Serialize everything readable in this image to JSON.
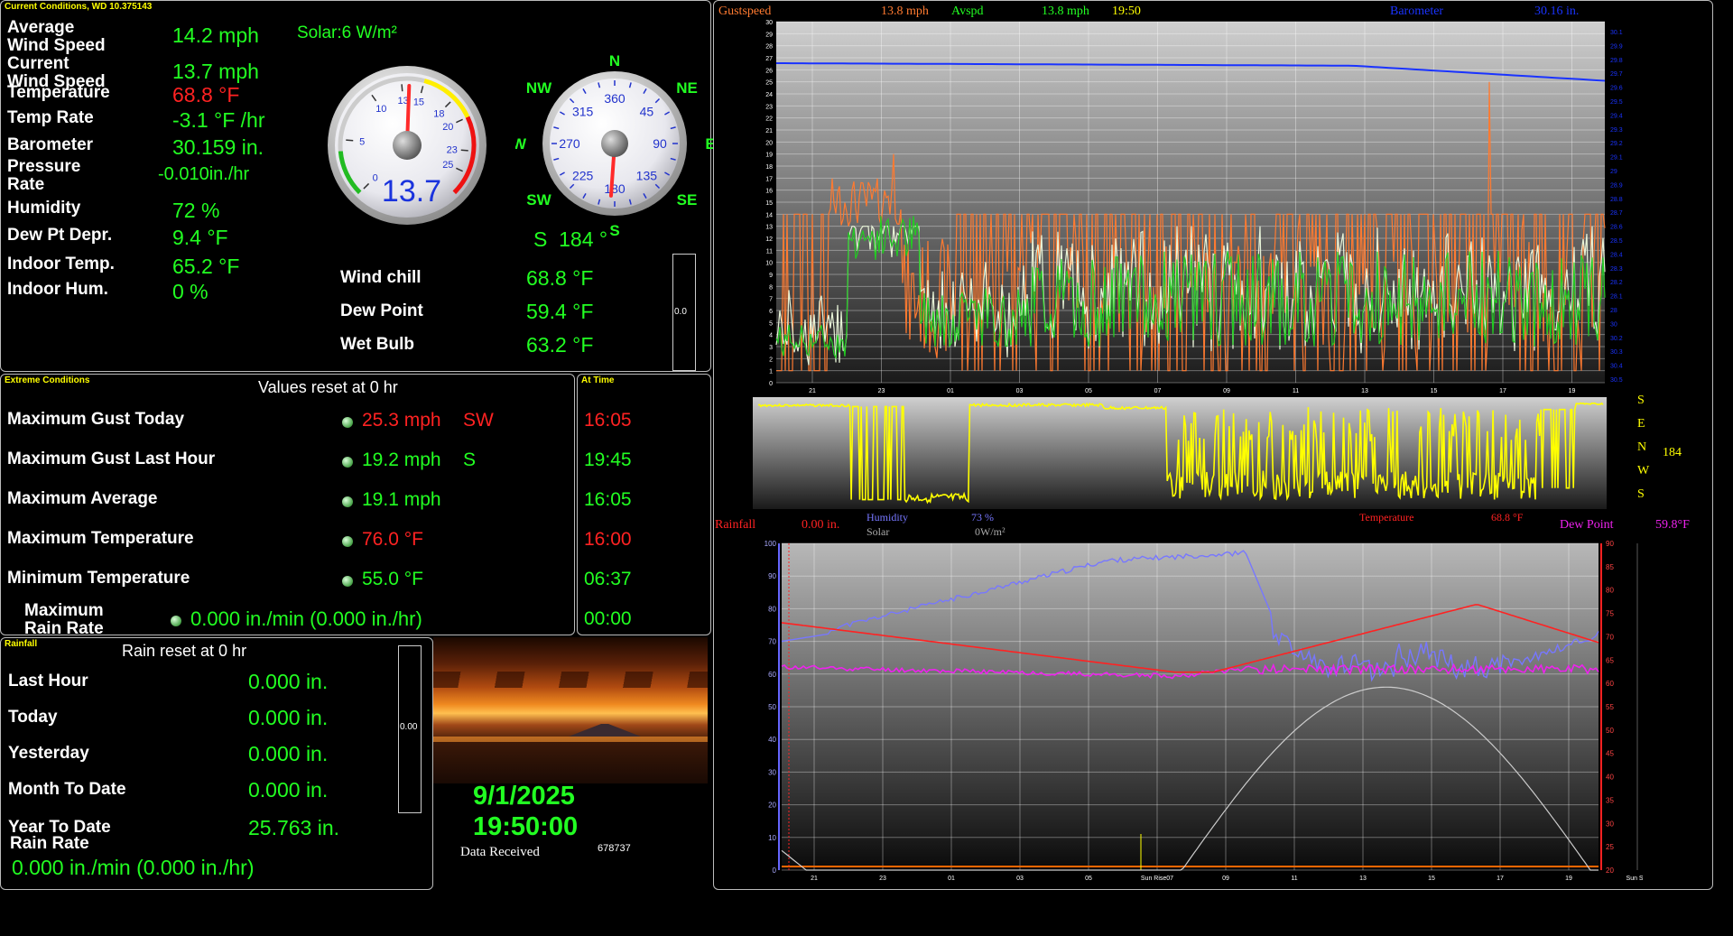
{
  "current": {
    "title": "Current Conditions, WD 10.375143",
    "solar": "Solar:6 W/m²",
    "rows": [
      {
        "label": "Average\nWind Speed",
        "value": "14.2 mph"
      },
      {
        "label": "Current\nWind Speed",
        "value": "13.7 mph"
      },
      {
        "label": "Temperature",
        "value": "68.8 °F"
      },
      {
        "label": "Temp Rate",
        "value": "-3.1 °F /hr"
      },
      {
        "label": "Barometer",
        "value": "30.159 in."
      },
      {
        "label": "Pressure\nRate",
        "value": "-0.010in./hr"
      },
      {
        "label": "Humidity",
        "value": "72 %"
      },
      {
        "label": "Dew Pt Depr.",
        "value": "9.4 °F"
      },
      {
        "label": "Indoor Temp.",
        "value": "65.2 °F"
      },
      {
        "label": "Indoor Hum.",
        "value": "0 %"
      }
    ],
    "extra_rows": [
      {
        "label": "Wind chill",
        "value": "68.8 °F"
      },
      {
        "label": "Dew Point",
        "value": "59.4 °F"
      },
      {
        "label": "Wet Bulb",
        "value": "63.2 °F"
      }
    ],
    "speed_gauge": {
      "value": 13.7,
      "readout": "13.7",
      "ticks": [
        "0",
        "5",
        "10",
        "13",
        "15",
        "18",
        "20",
        "23",
        "25"
      ]
    },
    "compass": {
      "direction_deg": 184,
      "readout": "S  184 °",
      "cardinals": {
        "N": "N",
        "NE": "NE",
        "E": "E",
        "SE": "SE",
        "S": "S",
        "SW": "SW",
        "W": "W",
        "NW": "NW"
      },
      "ticks": [
        "360",
        "45",
        "90",
        "135",
        "180",
        "225",
        "270",
        "315"
      ]
    },
    "meter_value": "0.0"
  },
  "extreme": {
    "title": "Extreme Conditions",
    "header": "Values reset at 0 hr",
    "time_title": "At Time",
    "rows": [
      {
        "label": "Maximum Gust Today",
        "value": "25.3 mph",
        "dir": "SW",
        "time": "16:05",
        "color": "#ff2222"
      },
      {
        "label": "Maximum Gust Last Hour",
        "value": "19.2 mph",
        "dir": "S",
        "time": "19:45",
        "color": "#22ff22"
      },
      {
        "label": "Maximum Average",
        "value": "19.1 mph",
        "dir": "",
        "time": "16:05",
        "color": "#22ff22"
      },
      {
        "label": "Maximum Temperature",
        "value": "76.0 °F",
        "dir": "",
        "time": "16:00",
        "color": "#ff2222"
      },
      {
        "label": "Minimum Temperature",
        "value": "55.0 °F",
        "dir": "",
        "time": "06:37",
        "color": "#22ff22"
      },
      {
        "label": "Maximum\nRain Rate",
        "value": "0.000 in./min (0.000 in./hr)",
        "dir": "",
        "time": "00:00",
        "color": "#22ff22"
      }
    ]
  },
  "rainfall": {
    "title": "Rainfall",
    "header": "Rain reset at 0 hr",
    "rows": [
      {
        "label": "Last Hour",
        "value": "0.000 in."
      },
      {
        "label": "Today",
        "value": "0.000 in."
      },
      {
        "label": "Yesterday",
        "value": "0.000 in."
      },
      {
        "label": "Month To Date",
        "value": "0.000 in."
      },
      {
        "label": "Year To Date",
        "value": "25.763 in."
      }
    ],
    "rate_label": "Rain Rate",
    "rate_value": "0.000 in./min (0.000 in./hr)",
    "meter_value": "0.00"
  },
  "status": {
    "date": "9/1/2025",
    "time": "19:50:00",
    "data_received_label": "Data Received",
    "data_received_count": "678737"
  },
  "wind_graph": {
    "gust_label": "Gustspeed",
    "gust_value": "13.8 mph",
    "avg_label": "Avspd",
    "avg_value": "13.8 mph",
    "time": "19:50",
    "baro_label": "Barometer",
    "baro_value": "30.16 in.",
    "y_ticks": [
      "0",
      "1",
      "2",
      "3",
      "4",
      "5",
      "6",
      "7",
      "8",
      "9",
      "10",
      "11",
      "12",
      "13",
      "14",
      "15",
      "16",
      "17",
      "18",
      "19",
      "20",
      "21",
      "22",
      "23",
      "24",
      "25",
      "26",
      "27",
      "28",
      "29",
      "30"
    ],
    "baro_ticks": [
      "30.1",
      "29.9",
      "29.8",
      "29.7",
      "29.6",
      "29.5",
      "29.4",
      "29.3",
      "29.2",
      "29.1",
      "29",
      "28.9",
      "28.8",
      "28.7",
      "28.6",
      "28.5",
      "28.4",
      "28.3",
      "28.2",
      "28.1",
      "28",
      "30",
      "30.2",
      "30.3",
      "30.4",
      "30.5"
    ],
    "x_ticks": [
      "21",
      "23",
      "01",
      "03",
      "05",
      "07",
      "09",
      "11",
      "13",
      "15",
      "17",
      "19"
    ]
  },
  "direction_graph": {
    "labels": [
      "S",
      "E",
      "N",
      "W",
      "S"
    ],
    "value": "184"
  },
  "lower_graph": {
    "rain_label": "Rainfall",
    "rain_value": "0.00 in.",
    "hum_label": "Humidity",
    "hum_value": "73 %",
    "solar_label": "Solar",
    "solar_value": "0W/m²",
    "temp_label": "Temperature",
    "temp_value": "68.8 °F",
    "dew_label": "Dew Point",
    "dew_value": "59.8°F",
    "left_ticks": [
      "100",
      "90",
      "80",
      "70",
      "60",
      "50",
      "40",
      "30",
      "20",
      "10",
      "0"
    ],
    "right_ticks": [
      "90",
      "85",
      "80",
      "75",
      "70",
      "65",
      "60",
      "55",
      "50",
      "45",
      "40",
      "35",
      "30",
      "25",
      "20"
    ],
    "x_ticks": [
      "21",
      "23",
      "01",
      "03",
      "05",
      "Sun Rise07",
      "09",
      "11",
      "13",
      "15",
      "17",
      "19",
      "Sun Set"
    ]
  },
  "colors": {
    "gust": "#ff7a30",
    "avg": "#22cc22",
    "baro": "#1a33ff",
    "temp": "#ff2222",
    "dew": "#ee22ee",
    "hum": "#7777ff",
    "solar": "#cccccc",
    "dir": "#ffff00"
  }
}
